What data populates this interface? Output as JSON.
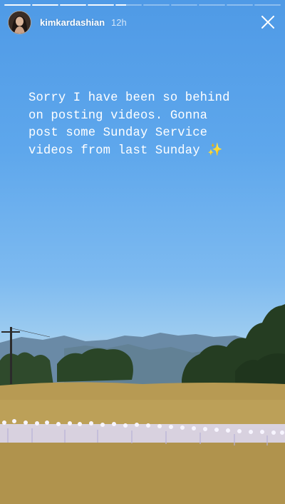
{
  "story": {
    "username": "kimkardashian",
    "time_ago": "12h",
    "caption_lines": [
      "Sorry I have been so behind",
      "on posting videos. Gonna",
      "post some Sunday Service",
      "videos from last Sunday"
    ],
    "caption_emoji": "✨",
    "progress": {
      "segments_done": 4,
      "segments_total": 10
    },
    "icons": {
      "avatar": "profile-avatar",
      "close": "close-icon"
    },
    "colors": {
      "sky_top": "#4f9ae6",
      "sky_bottom": "#aecfe8",
      "grass": "#b79a53"
    }
  }
}
